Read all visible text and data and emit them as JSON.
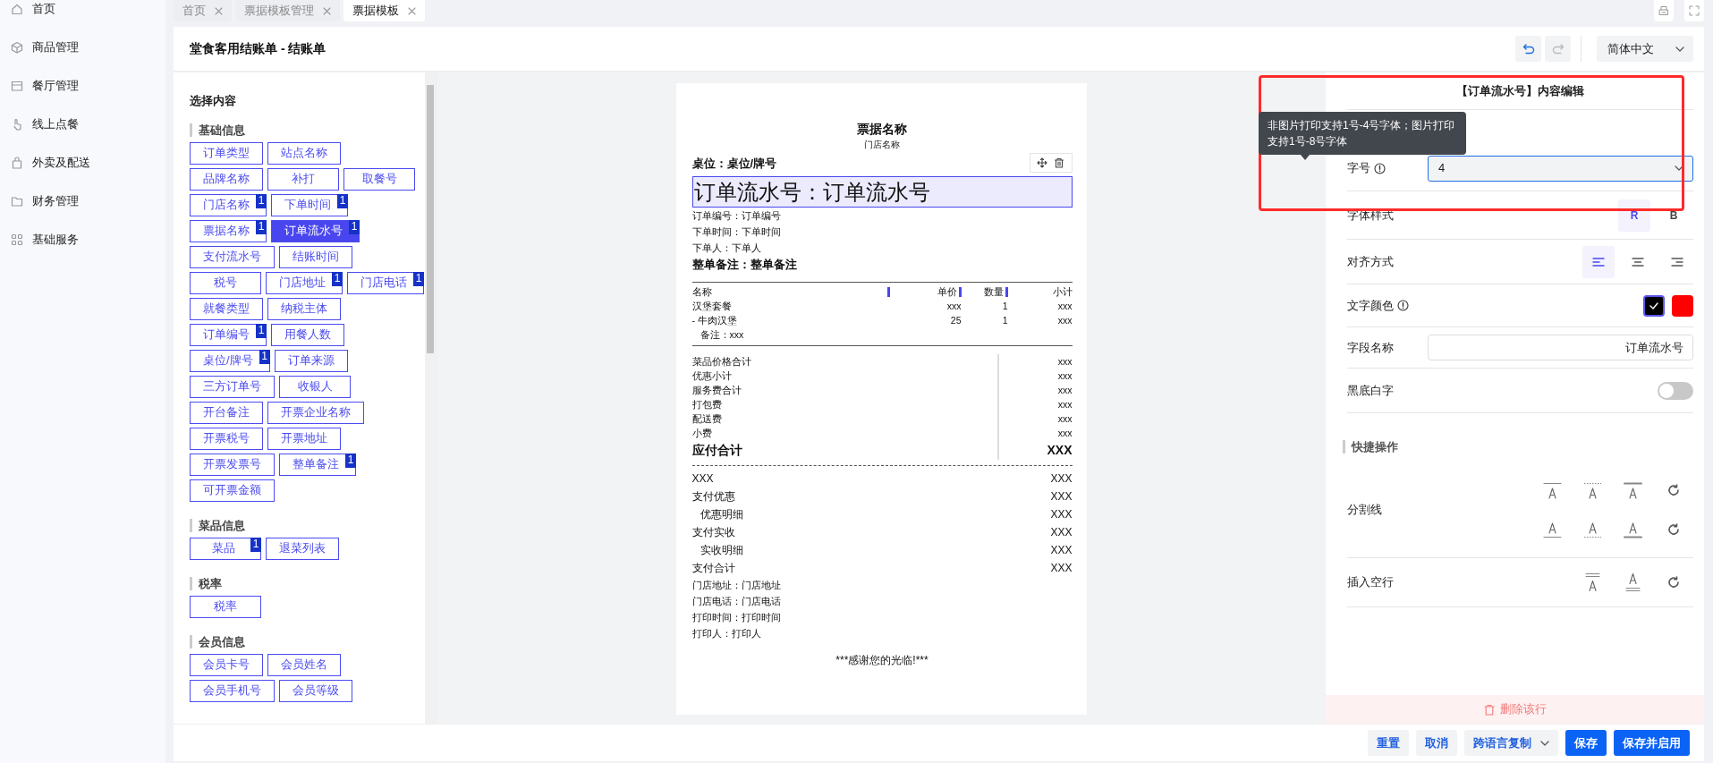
{
  "sidebar": {
    "items": [
      {
        "label": "首页"
      },
      {
        "label": "商品管理"
      },
      {
        "label": "餐厅管理"
      },
      {
        "label": "线上点餐"
      },
      {
        "label": "外卖及配送"
      },
      {
        "label": "财务管理"
      },
      {
        "label": "基础服务"
      }
    ]
  },
  "tabs": [
    {
      "label": "首页",
      "selected": false
    },
    {
      "label": "票据模板管理",
      "selected": false
    },
    {
      "label": "票据模板",
      "selected": true
    }
  ],
  "header": {
    "title": "堂食客用结账单 - 结账单",
    "undo_disabled": false,
    "redo_disabled": true,
    "language": "简体中文"
  },
  "picker": {
    "title": "选择内容",
    "groups": [
      {
        "title": "基础信息",
        "rows": [
          [
            {
              "label": "订单类型",
              "selected": false
            },
            {
              "label": "站点名称",
              "selected": false
            }
          ],
          [
            {
              "label": "品牌名称",
              "selected": false
            },
            {
              "label": "补打",
              "selected": false
            },
            {
              "label": "取餐号",
              "selected": false
            }
          ],
          [
            {
              "label": "门店名称",
              "badge": "1",
              "selected": false
            },
            {
              "label": "下单时间",
              "badge": "1",
              "selected": false
            }
          ],
          [
            {
              "label": "票据名称",
              "badge": "1",
              "selected": false
            },
            {
              "label": "订单流水号",
              "badge": "1",
              "selected": true
            }
          ],
          [
            {
              "label": "支付流水号",
              "selected": false
            },
            {
              "label": "结账时间",
              "selected": false
            }
          ],
          [
            {
              "label": "税号",
              "selected": false
            },
            {
              "label": "门店地址",
              "badge": "1",
              "selected": false
            },
            {
              "label": "门店电话",
              "badge": "1",
              "selected": false
            }
          ],
          [
            {
              "label": "就餐类型",
              "selected": false
            },
            {
              "label": "纳税主体",
              "selected": false
            }
          ],
          [
            {
              "label": "订单编号",
              "badge": "1",
              "selected": false
            },
            {
              "label": "用餐人数",
              "selected": false
            }
          ],
          [
            {
              "label": "桌位/牌号",
              "badge": "1",
              "selected": false
            },
            {
              "label": "订单来源",
              "selected": false
            }
          ],
          [
            {
              "label": "三方订单号",
              "selected": false
            },
            {
              "label": "收银人",
              "selected": false
            }
          ],
          [
            {
              "label": "开台备注",
              "selected": false
            },
            {
              "label": "开票企业名称",
              "selected": false
            }
          ],
          [
            {
              "label": "开票税号",
              "selected": false
            },
            {
              "label": "开票地址",
              "selected": false
            }
          ],
          [
            {
              "label": "开票发票号",
              "selected": false
            },
            {
              "label": "整单备注",
              "badge": "1",
              "selected": false
            }
          ],
          [
            {
              "label": "可开票金额",
              "selected": false
            }
          ]
        ]
      },
      {
        "title": "菜品信息",
        "rows": [
          [
            {
              "label": "菜品",
              "badge": "1",
              "selected": false
            },
            {
              "label": "退菜列表",
              "selected": false
            }
          ]
        ]
      },
      {
        "title": "税率",
        "rows": [
          [
            {
              "label": "税率",
              "selected": false
            }
          ]
        ]
      },
      {
        "title": "会员信息",
        "rows": [
          [
            {
              "label": "会员卡号",
              "selected": false
            },
            {
              "label": "会员姓名",
              "selected": false
            }
          ],
          [
            {
              "label": "会员手机号",
              "selected": false
            },
            {
              "label": "会员等级",
              "selected": false
            }
          ]
        ]
      }
    ]
  },
  "receipt": {
    "blocks": [
      {
        "kind": "title",
        "text": "票据名称",
        "selected": false
      },
      {
        "kind": "subtitle",
        "text": "门店名称",
        "selected": false
      },
      {
        "kind": "bold-line",
        "text": "桌位：桌位/牌号",
        "selected": false
      },
      {
        "kind": "large-line",
        "text": "订单流水号：订单流水号",
        "selected": true
      },
      {
        "kind": "line",
        "text": "订单编号：订单编号",
        "selected": false
      },
      {
        "kind": "line",
        "text": "下单时间：下单时间",
        "selected": false
      },
      {
        "kind": "line",
        "text": "下单人：下单人",
        "selected": false
      },
      {
        "kind": "bold-line",
        "text": "整单备注：整单备注",
        "selected": false
      },
      {
        "kind": "items-table",
        "selected": false,
        "columns": [
          "名称",
          "单价",
          "数量",
          "小计"
        ],
        "rows": [
          [
            "汉堡套餐",
            "xxx",
            "1",
            "xxx"
          ],
          [
            "- 牛肉汉堡",
            "25",
            "1",
            "xxx"
          ]
        ],
        "note": "备注：xxx"
      },
      {
        "kind": "summary",
        "selected": false,
        "rows": [
          [
            "菜品价格合计",
            "xxx"
          ],
          [
            "优惠小计",
            "xxx"
          ],
          [
            "服务费合计",
            "xxx"
          ],
          [
            "打包费",
            "xxx"
          ],
          [
            "配送费",
            "xxx"
          ],
          [
            "小费",
            "xxx"
          ]
        ],
        "total": [
          "应付合计",
          "XXX"
        ]
      },
      {
        "kind": "dashed",
        "selected": false
      },
      {
        "kind": "payments",
        "selected": false,
        "rows": [
          {
            "label": "XXX",
            "value": "XXX"
          },
          {
            "label": "支付优惠",
            "value": "XXX",
            "children": [
              {
                "label": "优惠明细",
                "value": "XXX"
              }
            ]
          },
          {
            "label": "支付实收",
            "value": "XXX",
            "children": [
              {
                "label": "实收明细",
                "value": "XXX"
              }
            ]
          },
          {
            "label": "支付合计",
            "value": "XXX"
          }
        ]
      },
      {
        "kind": "line",
        "text": "门店地址：门店地址",
        "selected": false
      },
      {
        "kind": "line",
        "text": "门店电话：门店电话",
        "selected": false
      },
      {
        "kind": "line",
        "text": "打印时间：打印时间",
        "selected": false
      },
      {
        "kind": "line",
        "text": "打印人：打印人",
        "selected": false
      },
      {
        "kind": "footer",
        "text": "***感谢您的光临!***",
        "selected": false
      }
    ]
  },
  "editor": {
    "title": "【订单流水号】内容编辑",
    "tooltip": "非图片打印支持1号-4号字体；图片打印支持1号-8号字体",
    "rows": [
      {
        "kind": "select",
        "label": "字号",
        "info": true,
        "value": "4"
      },
      {
        "kind": "styles",
        "label": "字体样式",
        "info": false,
        "options": [
          {
            "label": "R",
            "selected": true
          },
          {
            "label": "B",
            "selected": false
          }
        ]
      },
      {
        "kind": "align",
        "label": "对齐方式",
        "info": false,
        "options": [
          {
            "kind": "left",
            "selected": true
          },
          {
            "kind": "center",
            "selected": false
          },
          {
            "kind": "right",
            "selected": false
          }
        ]
      },
      {
        "kind": "colors",
        "label": "文字颜色",
        "info": true,
        "swatches": [
          {
            "color": "#000000",
            "selected": true
          },
          {
            "color": "#ff0000",
            "selected": false
          }
        ]
      },
      {
        "kind": "input",
        "label": "字段名称",
        "info": false,
        "value": "订单流水号"
      },
      {
        "kind": "switch",
        "label": "黑底白字",
        "info": false,
        "on": false
      }
    ],
    "quick": {
      "title": "快捷操作",
      "rows": [
        {
          "kind": "dividers",
          "label": "分割线"
        },
        {
          "kind": "blank-lines",
          "label": "插入空行"
        }
      ]
    },
    "delete": "删除该行"
  },
  "footer": {
    "buttons": [
      {
        "label": "重置",
        "kind": "light"
      },
      {
        "label": "取消",
        "kind": "light"
      },
      {
        "label": "跨语言复制",
        "kind": "dropdown"
      },
      {
        "label": "保存",
        "kind": "primary"
      },
      {
        "label": "保存并启用",
        "kind": "primary"
      }
    ]
  }
}
